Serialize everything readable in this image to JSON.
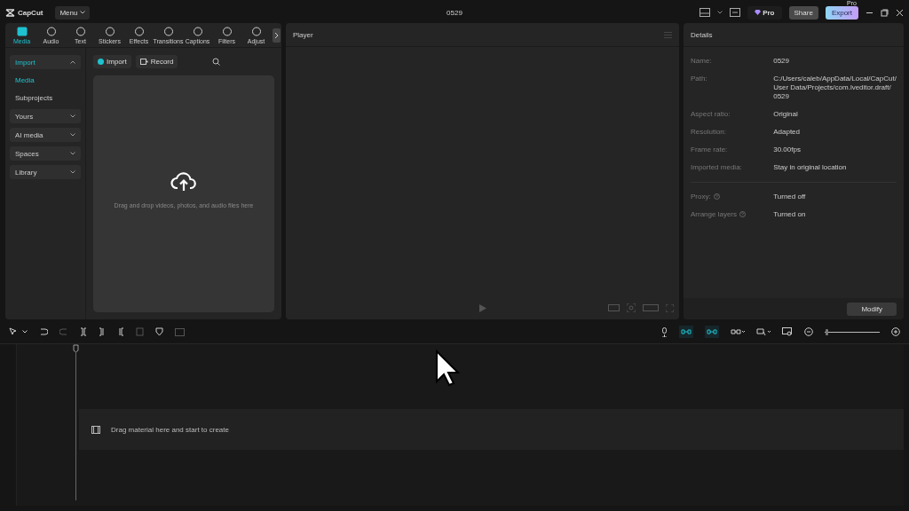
{
  "app": {
    "name": "CapCut",
    "menu": "Menu"
  },
  "window": {
    "title": "0529"
  },
  "top_actions": {
    "pro": "Pro",
    "share": "Share",
    "export": "Export",
    "export_badge": "Pro"
  },
  "media_tabs": [
    {
      "label": "Media",
      "selected": true
    },
    {
      "label": "Audio",
      "selected": false
    },
    {
      "label": "Text",
      "selected": false
    },
    {
      "label": "Stickers",
      "selected": false
    },
    {
      "label": "Effects",
      "selected": false
    },
    {
      "label": "Transitions",
      "selected": false
    },
    {
      "label": "Captions",
      "selected": false
    },
    {
      "label": "Filters",
      "selected": false
    },
    {
      "label": "Adjust",
      "selected": false
    }
  ],
  "sidebar": [
    {
      "label": "Import",
      "selected": true,
      "expanded": true,
      "children": [
        {
          "label": "Media",
          "selected": true
        },
        {
          "label": "Subprojects",
          "selected": false
        }
      ]
    },
    {
      "label": "Yours",
      "selected": false,
      "expanded": false
    },
    {
      "label": "AI media",
      "selected": false,
      "expanded": false
    },
    {
      "label": "Spaces",
      "selected": false,
      "expanded": false
    },
    {
      "label": "Library",
      "selected": false,
      "expanded": false
    }
  ],
  "media_toolbar": {
    "import": "Import",
    "record": "Record"
  },
  "drop_zone": {
    "text": "Drag and drop videos, photos, and audio files here"
  },
  "player": {
    "title": "Player"
  },
  "details": {
    "title": "Details",
    "groups": [
      [
        {
          "label": "Name:",
          "value": "0529",
          "help": false
        },
        {
          "label": "Path:",
          "value": "C:/Users/caleb/AppData/Local/CapCut/ User Data/Projects/com.lveditor.draft/ 0529",
          "help": false
        },
        {
          "label": "Aspect ratio:",
          "value": "Original",
          "help": false
        },
        {
          "label": "Resolution:",
          "value": "Adapted",
          "help": false
        },
        {
          "label": "Frame rate:",
          "value": "30.00fps",
          "help": false
        },
        {
          "label": "Imported media:",
          "value": "Stay in original location",
          "help": false
        }
      ],
      [
        {
          "label": "Proxy:",
          "value": "Turned off",
          "help": true
        },
        {
          "label": "Arrange layers",
          "value": "Turned on",
          "help": true
        }
      ]
    ],
    "modify": "Modify"
  },
  "timeline_toggles": [
    {
      "on": true
    },
    {
      "on": true
    }
  ],
  "timeline_zoom": {
    "level": 0.02
  },
  "timeline": {
    "placeholder": "Drag material here and start to create"
  }
}
